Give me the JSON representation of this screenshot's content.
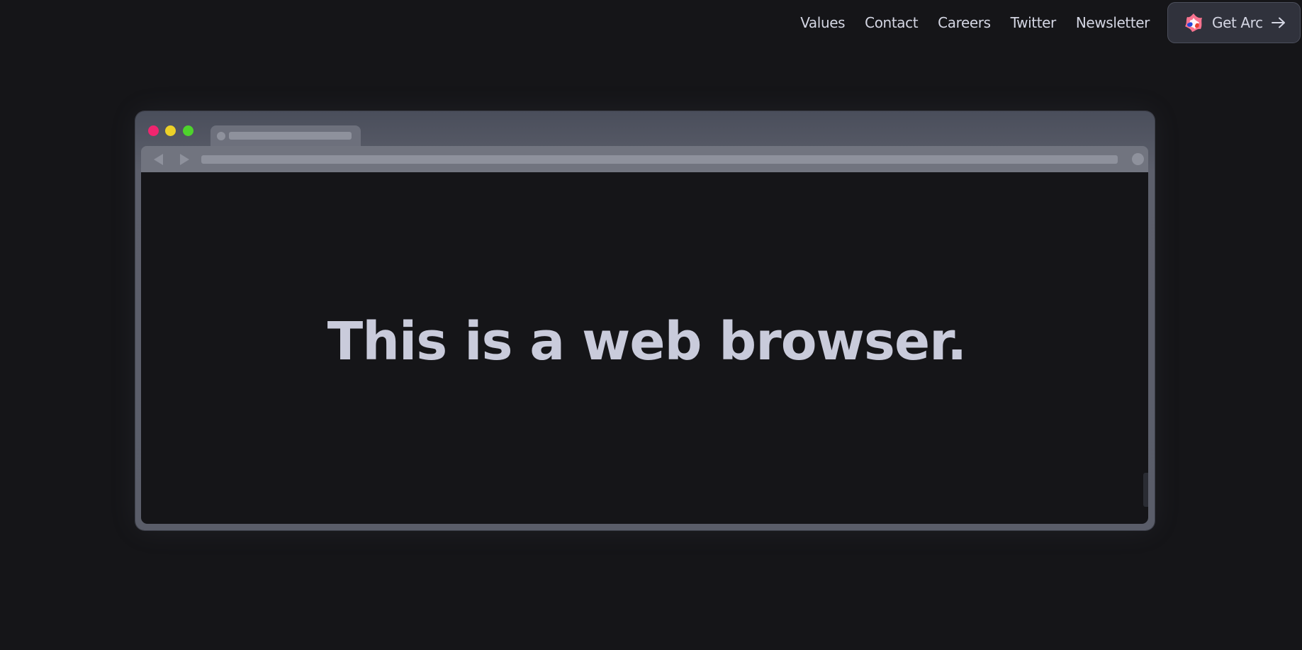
{
  "nav": {
    "links": [
      "Values",
      "Contact",
      "Careers",
      "Twitter",
      "Newsletter"
    ],
    "cta": {
      "label": "Get Arc",
      "logo_icon": "arc-logo-icon",
      "arrow_icon": "arrow-right-icon"
    }
  },
  "browser_mock": {
    "traffic_lights": {
      "close": "#f0256f",
      "minimize": "#ecd128",
      "maximize": "#4ed32c"
    },
    "headline": "This is a web browser."
  },
  "colors": {
    "background": "#151518",
    "text": "#d4d6e3",
    "headline": "#c9cbdb",
    "button_bg": "#30323c"
  }
}
